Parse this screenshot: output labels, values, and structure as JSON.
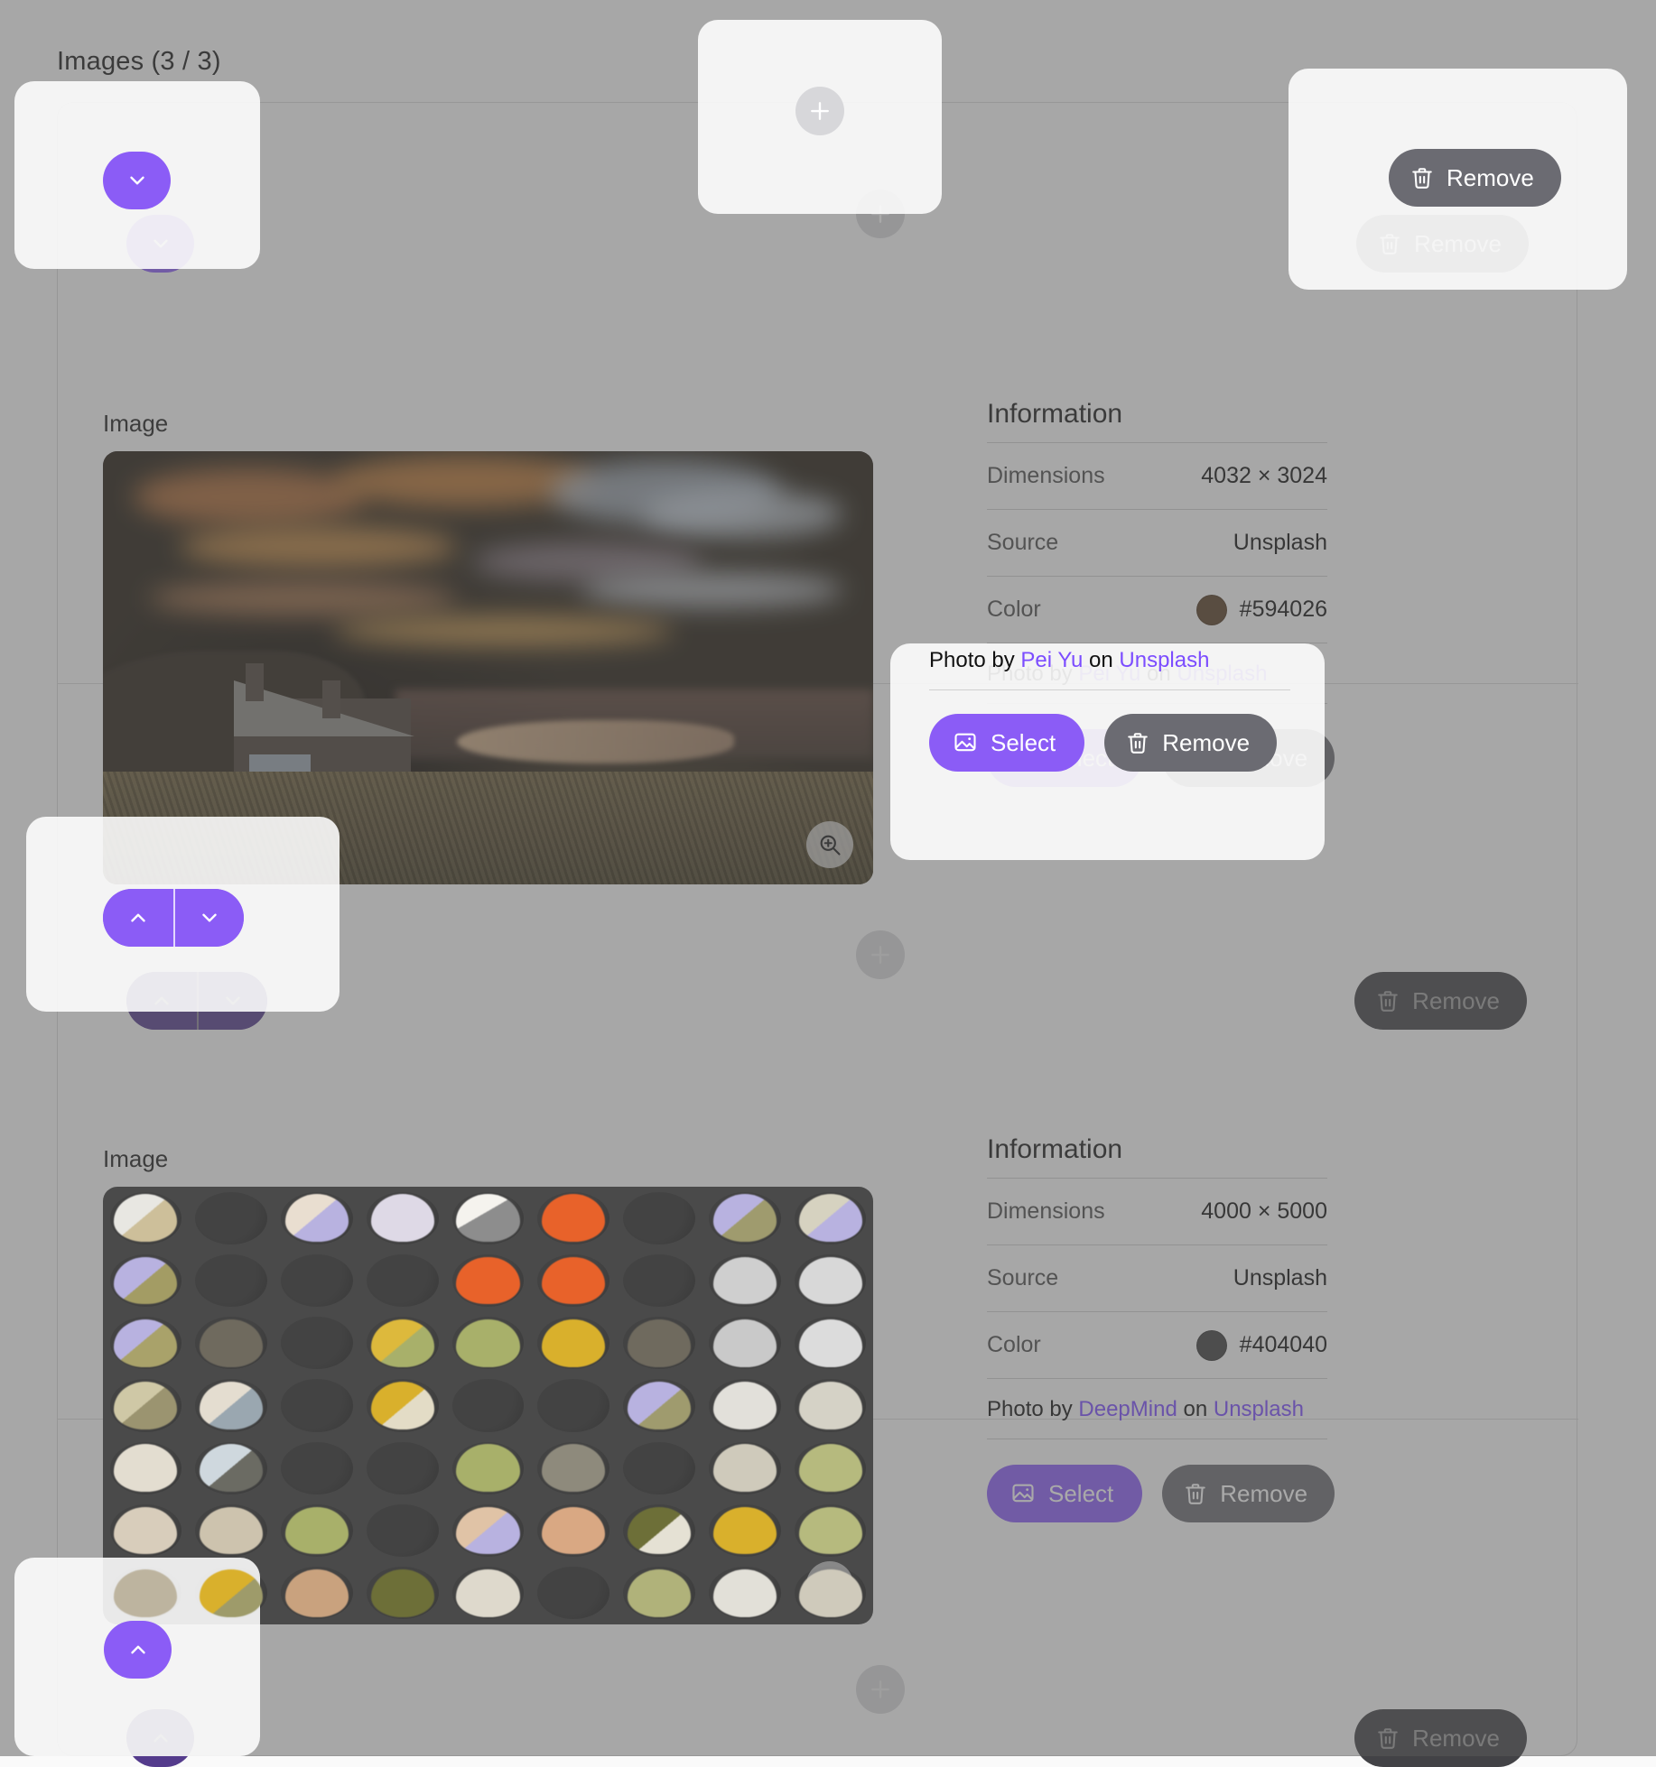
{
  "page": {
    "title": "Images (3 / 3)"
  },
  "toolbar": {
    "collapse_icon": "chevron-down-icon",
    "add_icon": "plus-icon",
    "remove_label": "Remove",
    "remove_icon": "trash-icon"
  },
  "controls": {
    "move_up_icon": "chevron-up-icon",
    "move_down_icon": "chevron-down-icon",
    "add_icon": "plus-icon",
    "zoom_icon": "zoom-in-icon",
    "select_icon": "image-icon",
    "trash_icon": "trash-icon"
  },
  "labels": {
    "image": "Image",
    "information": "Information",
    "dimensions": "Dimensions",
    "source": "Source",
    "color": "Color",
    "select": "Select",
    "remove": "Remove",
    "photo_by": "Photo by",
    "on": "on"
  },
  "items": [
    {
      "image_label": "Image",
      "info_title": "Information",
      "dimensions": "4032 × 3024",
      "source": "Unsplash",
      "color_hex": "#594026",
      "color_swatch": "#594026",
      "author": "Pei Yu",
      "platform": "Unsplash",
      "select_label": "Select",
      "remove_label": "Remove",
      "row_remove_label": "Remove"
    },
    {
      "image_label": "Image",
      "info_title": "Information",
      "dimensions": "4000 × 5000",
      "source": "Unsplash",
      "color_hex": "#404040",
      "color_swatch": "#404040",
      "author": "DeepMind",
      "platform": "Unsplash",
      "select_label": "Select",
      "remove_label": "Remove",
      "row_remove_label": "Remove"
    },
    {
      "row_remove_label": "Remove"
    }
  ],
  "theme": {
    "accent": "#8b5cf6",
    "neutral_button": "#6b6b72",
    "link": "#7c4dff",
    "scrim": "rgba(90,90,90,0.52)"
  }
}
